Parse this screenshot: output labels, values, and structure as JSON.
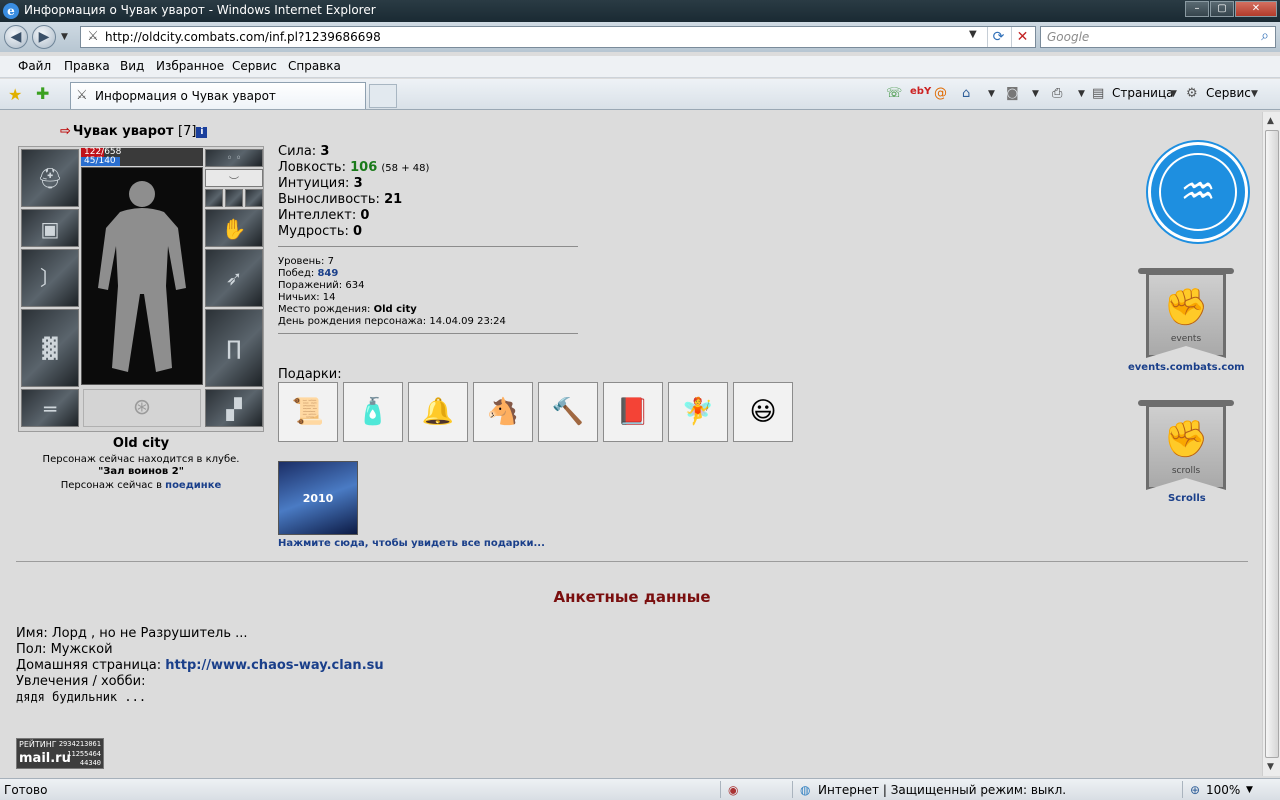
{
  "window": {
    "title": "Информация о Чувак уварот - Windows Internet Explorer",
    "btn_minimize": "–",
    "btn_maximize": "▢",
    "btn_close": "✕"
  },
  "address": {
    "url": "http://oldcity.combats.com/inf.pl?1239686698",
    "search_placeholder": "Google"
  },
  "menu": [
    "Файл",
    "Правка",
    "Вид",
    "Избранное",
    "Сервис",
    "Справка"
  ],
  "tabs": {
    "active_label": "Информация о Чувак уварот",
    "toolbar_page": "Страница",
    "toolbar_service": "Сервис"
  },
  "character": {
    "name": "Чувак уварот",
    "level_badge": "[7]",
    "hp_text": "122/658",
    "hp_fraction": 0.185,
    "mp_text": "45/140",
    "mp_fraction": 0.321,
    "city": "Old city",
    "club_line": "Персонаж сейчас находится в клубе.",
    "club_name": "\"Зал воинов 2\"",
    "fight_prefix": "Персонаж сейчас в",
    "fight_link": "поединке"
  },
  "stats": [
    {
      "label": "Сила:",
      "value": "3"
    },
    {
      "label": "Ловкость:",
      "value": "106",
      "extra": "(58 + 48)"
    },
    {
      "label": "Интуиция:",
      "value": "3"
    },
    {
      "label": "Выносливость:",
      "value": "21"
    },
    {
      "label": "Интеллект:",
      "value": "0"
    },
    {
      "label": "Мудрость:",
      "value": "0"
    }
  ],
  "details": {
    "level_label": "Уровень:",
    "level": "7",
    "wins_label": "Побед:",
    "wins": "849",
    "losses_label": "Поражений:",
    "losses": "634",
    "draws_label": "Ничьих:",
    "draws": "14",
    "birthplace_label": "Место рождения:",
    "birthplace": "Old city",
    "birthday_label": "День рождения персонажа:",
    "birthday": "14.04.09 23:24"
  },
  "gifts": {
    "label": "Подарки:",
    "items": [
      "📜",
      "🧴",
      "🔔",
      "🐴",
      "🔨",
      "📕",
      "🧚",
      "😃"
    ],
    "big_label": "2010",
    "all_link": "Нажмите сюда, чтобы увидеть все подарки..."
  },
  "emblems": {
    "events_label": "events",
    "events_link": "events.combats.com",
    "scrolls_label": "scrolls",
    "scrolls_link": "Scrolls"
  },
  "anketa": {
    "title": "Анкетные данные",
    "name_label": "Имя:",
    "name": "Лорд , но не Разрушитель ...",
    "gender_label": "Пол:",
    "gender": "Мужской",
    "home_label": "Домашняя страница:",
    "home": "http://www.chaos-way.clan.su",
    "hobby_label": "Увлечения / хобби:",
    "hobby": "дядя будильник ..."
  },
  "counter": {
    "label": "РЕЙТИНГ",
    "brand": "mail.ru",
    "n1": "2934213061",
    "n2": "11255464",
    "n3": "44340"
  },
  "status": {
    "left": "Готово",
    "zone": "Интернет | Защищенный режим: выкл.",
    "zoom": "100%"
  }
}
